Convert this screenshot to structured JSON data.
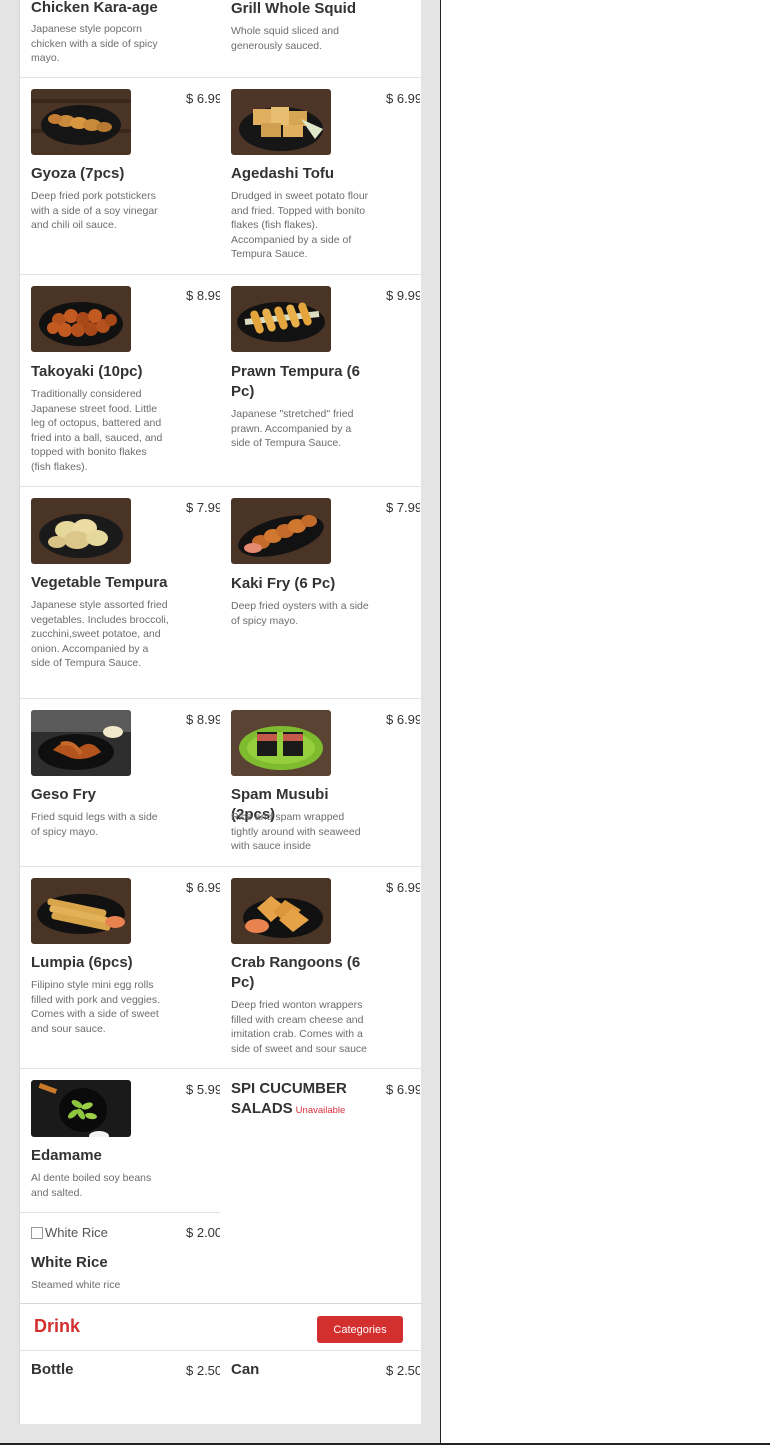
{
  "menu": {
    "rows": [
      {
        "left": {
          "name": "Chicken Kara-age",
          "desc": "Japanese style popcorn chicken with a side of spicy mayo.",
          "price": ""
        },
        "right": {
          "name": "Grill Whole Squid",
          "desc": "Whole squid sliced and generously sauced.",
          "price": ""
        }
      },
      {
        "left": {
          "name": "Gyoza (7pcs)",
          "desc": "Deep fried pork potstickers with a side of a soy vinegar and chili oil sauce.",
          "price": "$ 6.99"
        },
        "right": {
          "name": "Agedashi Tofu",
          "desc": "Drudged in sweet potato flour and fried. Topped with bonito flakes (fish flakes). Accompanied by a side of Tempura Sauce.",
          "price": "$ 6.99"
        }
      },
      {
        "left": {
          "name": "Takoyaki (10pc)",
          "desc": "Traditionally considered Japanese street food. Little leg of octopus, battered and fried into a ball, sauced, and topped with bonito flakes (fish flakes).",
          "price": "$ 8.99"
        },
        "right": {
          "name": "Prawn Tempura (6 Pc)",
          "desc": "Japanese \"stretched\" fried prawn. Accompanied by a side of Tempura Sauce.",
          "price": "$ 9.99"
        }
      },
      {
        "left": {
          "name": "Vegetable Tempura",
          "desc": "Japanese style assorted fried vegetables. Includes broccoli, zucchini,sweet potatoe, and onion. Accompanied by a side of Tempura Sauce.",
          "price": "$ 7.99"
        },
        "right": {
          "name": "Kaki Fry (6 Pc)",
          "desc": "Deep fried oysters with a side of spicy mayo.",
          "price": "$ 7.99"
        }
      },
      {
        "left": {
          "name": "Geso Fry",
          "desc": "Fried squid legs with a side of spicy mayo.",
          "price": "$ 8.99"
        },
        "right": {
          "name": "Spam Musubi (2pcs)",
          "desc": "Rice and spam wrapped tightly around with seaweed with sauce inside",
          "price": "$ 6.99"
        }
      },
      {
        "left": {
          "name": "Lumpia (6pcs)",
          "desc": "Filipino style mini egg rolls filled with pork and veggies. Comes with a side of sweet and sour sauce.",
          "price": "$ 6.99"
        },
        "right": {
          "name": "Crab Rangoons (6 Pc)",
          "desc": "Deep fried wonton wrappers filled with cream cheese and imitation crab. Comes with a side of sweet and sour sauce",
          "price": "$ 6.99"
        }
      },
      {
        "left": {
          "name": "Edamame",
          "desc": "Al dente boiled soy beans and salted.",
          "price": "$ 5.99"
        },
        "right": {
          "name": "SPI CUCUMBER SALADS",
          "status": "Unavailable",
          "price": "$ 6.99"
        }
      },
      {
        "left": {
          "name": "White Rice",
          "desc": "Steamed white rice",
          "price": "$ 2.00",
          "img_alt": "White Rice"
        }
      }
    ],
    "drink_section": {
      "title": "Drink",
      "categories_button": "Categories",
      "items": [
        {
          "name": "Bottle",
          "price": "$ 2.50"
        },
        {
          "name": "Can",
          "price": "$ 2.50"
        }
      ]
    }
  },
  "colors": {
    "accent": "#d32f2f",
    "text": "#333333",
    "muted": "#6d6d6d"
  }
}
